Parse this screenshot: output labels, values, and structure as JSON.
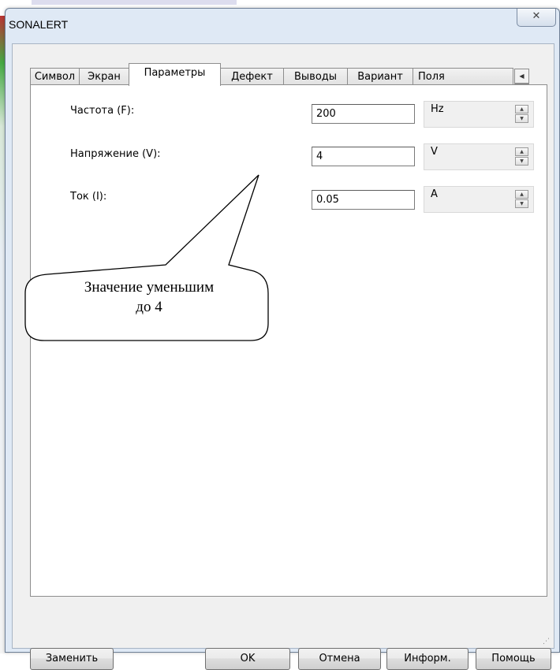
{
  "window": {
    "title": "SONALERT",
    "close_glyph": "✕"
  },
  "tabs": [
    {
      "label": "Символ",
      "active": false
    },
    {
      "label": "Экран",
      "active": false
    },
    {
      "label": "Параметры",
      "active": true
    },
    {
      "label": "Дефект",
      "active": false
    },
    {
      "label": "Выводы",
      "active": false
    },
    {
      "label": "Вариант",
      "active": false
    },
    {
      "label": "Поля",
      "active": false
    }
  ],
  "tab_scroll": {
    "left": "◀",
    "right": "▶"
  },
  "params": [
    {
      "label": "Частота (F):",
      "value": "200",
      "unit": "Hz"
    },
    {
      "label": "Напряжение (V):",
      "value": "4",
      "unit": "V"
    },
    {
      "label": "Ток (I):",
      "value": "0.05",
      "unit": "A"
    }
  ],
  "spinner": {
    "up": "▲",
    "down": "▼"
  },
  "callout": {
    "line1": "Значение уменьшим",
    "line2": "до 4"
  },
  "buttons": {
    "replace": "Заменить",
    "ok": "OK",
    "cancel": "Отмена",
    "info": "Информ.",
    "help": "Помощь"
  }
}
